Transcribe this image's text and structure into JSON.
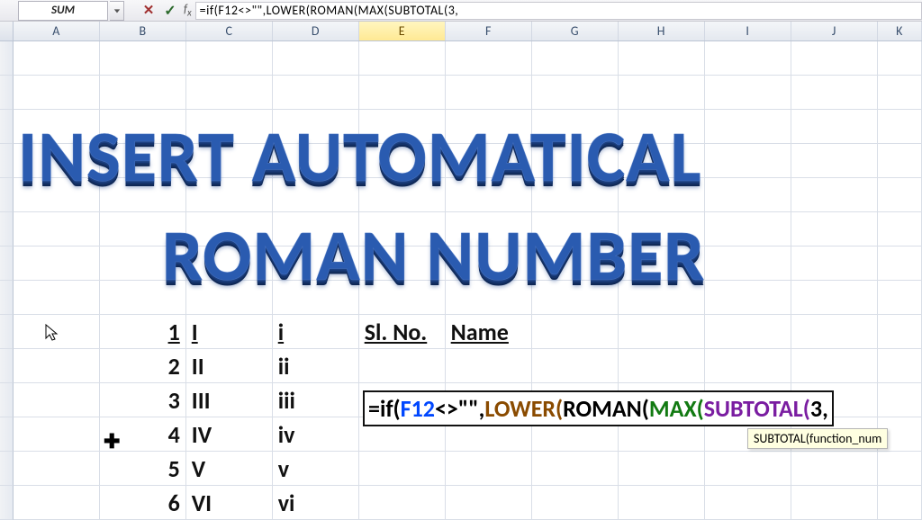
{
  "namebox": "SUM",
  "formula_bar": {
    "prefix": "=if(",
    "ref": "F12",
    "mid1": "<>\"\",",
    "fnLower": "LOWER(",
    "fnRoman": "ROMAN(",
    "fnMax": "MAX(",
    "fnSubtotal": "SUBTOTAL(",
    "trail": "3,"
  },
  "columns": [
    "A",
    "B",
    "C",
    "D",
    "E",
    "F",
    "G",
    "H",
    "I",
    "J",
    "K"
  ],
  "active_col": "E",
  "wordart_line1": "INSERT AUTOMATICAL",
  "wordart_line2": "ROMAN NUMBER",
  "headers": {
    "sl": "Sl. No.",
    "name": "Name"
  },
  "rows": [
    {
      "n": "1",
      "upper": "I",
      "lower": "i"
    },
    {
      "n": "2",
      "upper": "II",
      "lower": "ii"
    },
    {
      "n": "3",
      "upper": "III",
      "lower": "iii"
    },
    {
      "n": "4",
      "upper": "IV",
      "lower": "iv"
    },
    {
      "n": "5",
      "upper": "V",
      "lower": "v"
    },
    {
      "n": "6",
      "upper": "VI",
      "lower": "vi"
    }
  ],
  "editing_formula": {
    "prefix": "=if(",
    "ref": "F12",
    "mid1": "<>\"\",",
    "fnLower": "LOWER(",
    "fnRoman": "ROMAN(",
    "fnMax": "MAX(",
    "fnSubtotal": "SUBTOTAL(",
    "trail": "3,"
  },
  "tooltip": "SUBTOTAL(function_num"
}
